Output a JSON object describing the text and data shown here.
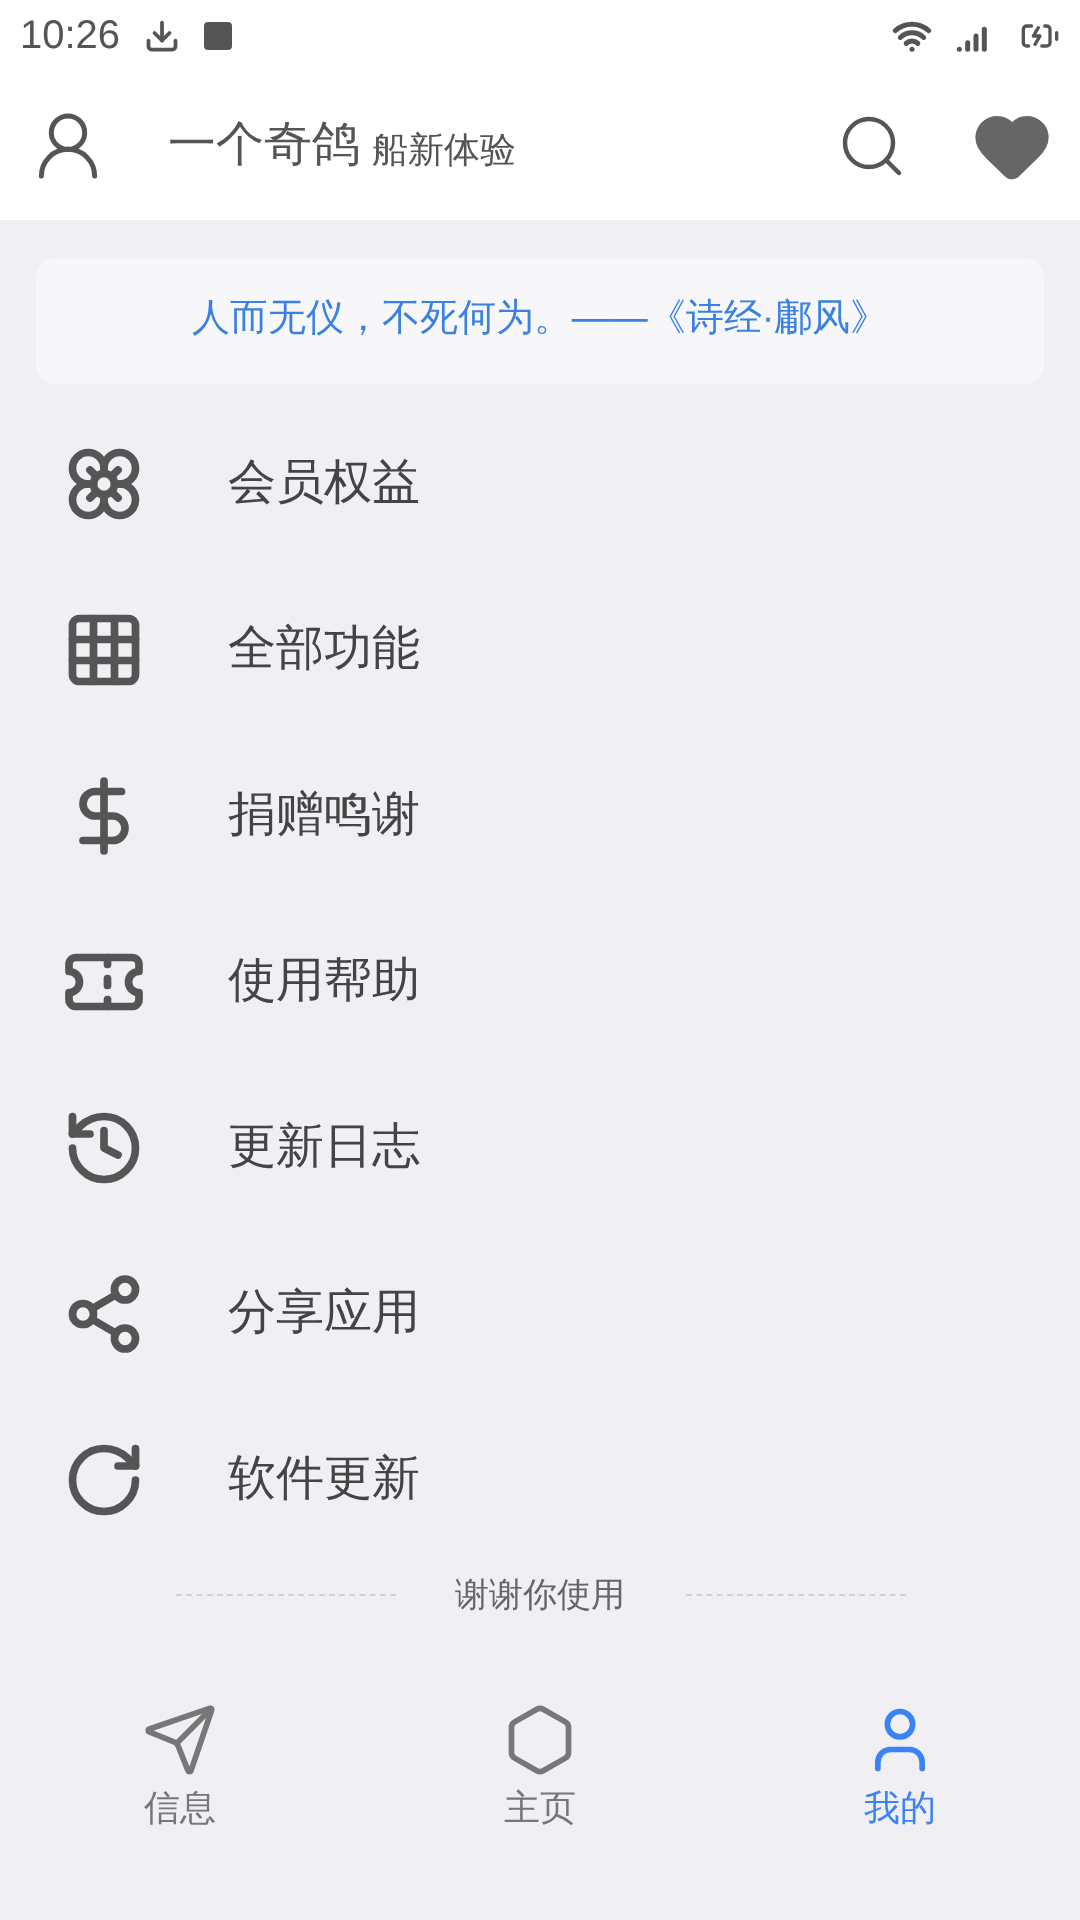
{
  "status_bar": {
    "time": "10:26"
  },
  "header": {
    "title": "一个奇鸽",
    "subtitle": "船新体验"
  },
  "quote": "人而无仪，不死何为。——《诗经·鄘风》",
  "menu": [
    {
      "label": "会员权益"
    },
    {
      "label": "全部功能"
    },
    {
      "label": "捐赠鸣谢"
    },
    {
      "label": "使用帮助"
    },
    {
      "label": "更新日志"
    },
    {
      "label": "分享应用"
    },
    {
      "label": "软件更新"
    }
  ],
  "footer_note": "谢谢你使用",
  "bottom_nav": [
    {
      "label": "信息",
      "selected": false
    },
    {
      "label": "主页",
      "selected": false
    },
    {
      "label": "我的",
      "selected": true
    }
  ]
}
